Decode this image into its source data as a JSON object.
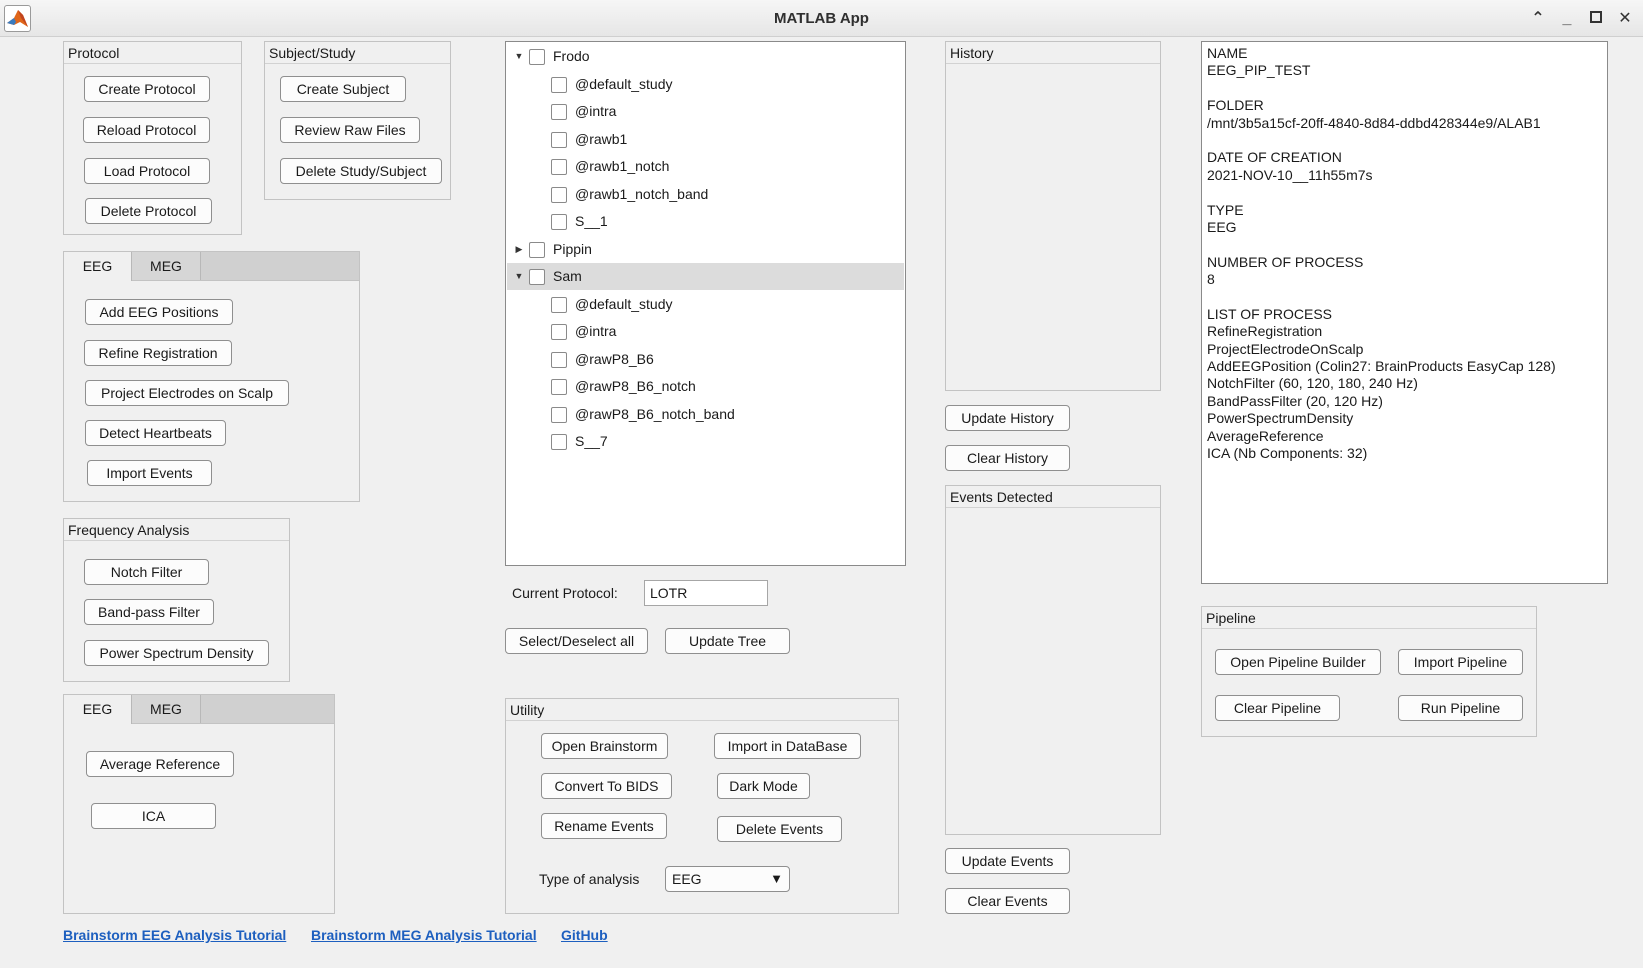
{
  "window": {
    "title": "MATLAB App",
    "icon": "matlab-logo-icon"
  },
  "protocol_panel": {
    "title": "Protocol",
    "buttons": [
      "Create Protocol",
      "Reload Protocol",
      "Load Protocol",
      "Delete Protocol"
    ]
  },
  "subject_panel": {
    "title": "Subject/Study",
    "buttons": [
      "Create Subject",
      "Review Raw Files",
      "Delete Study/Subject"
    ]
  },
  "tabs_top": {
    "tabs": [
      "EEG",
      "MEG"
    ],
    "active": "EEG",
    "buttons": [
      "Add EEG Positions",
      "Refine Registration",
      "Project Electrodes on Scalp",
      "Detect Heartbeats",
      "Import Events"
    ]
  },
  "frequency_panel": {
    "title": "Frequency Analysis",
    "buttons": [
      "Notch Filter",
      "Band-pass Filter",
      "Power Spectrum Density"
    ]
  },
  "tabs_bottom": {
    "tabs": [
      "EEG",
      "MEG"
    ],
    "active": "EEG",
    "buttons": [
      "Average Reference",
      "ICA"
    ]
  },
  "links": [
    "Brainstorm EEG Analysis Tutorial",
    "Brainstorm MEG Analysis Tutorial",
    "GitHub"
  ],
  "tree": {
    "nodes": [
      {
        "label": "Frodo",
        "level": 0,
        "expanded": true
      },
      {
        "label": "@default_study",
        "level": 1
      },
      {
        "label": "@intra",
        "level": 1
      },
      {
        "label": "@rawb1",
        "level": 1
      },
      {
        "label": "@rawb1_notch",
        "level": 1
      },
      {
        "label": "@rawb1_notch_band",
        "level": 1
      },
      {
        "label": "S__1",
        "level": 1
      },
      {
        "label": "Pippin",
        "level": 0,
        "expanded": false
      },
      {
        "label": "Sam",
        "level": 0,
        "expanded": true,
        "selected": true
      },
      {
        "label": "@default_study",
        "level": 1
      },
      {
        "label": "@intra",
        "level": 1
      },
      {
        "label": "@rawP8_B6",
        "level": 1
      },
      {
        "label": "@rawP8_B6_notch",
        "level": 1
      },
      {
        "label": "@rawP8_B6_notch_band",
        "level": 1
      },
      {
        "label": "S__7",
        "level": 1
      }
    ]
  },
  "current_protocol": {
    "label": "Current Protocol:",
    "value": "LOTR"
  },
  "tree_buttons": {
    "select_all": "Select/Deselect all",
    "update_tree": "Update Tree"
  },
  "utility_panel": {
    "title": "Utility",
    "buttons": {
      "open_brainstorm": "Open Brainstorm",
      "import_db": "Import in DataBase",
      "convert_bids": "Convert To BIDS",
      "dark_mode": "Dark Mode",
      "rename_events": "Rename Events",
      "delete_events": "Delete Events"
    },
    "analysis_label": "Type of analysis",
    "analysis_value": "EEG"
  },
  "history_panel": {
    "title": "History",
    "update": "Update History",
    "clear": "Clear History"
  },
  "events_panel": {
    "title": "Events Detected",
    "update": "Update Events",
    "clear": "Clear Events"
  },
  "info_text": [
    "NAME",
    "EEG_PIP_TEST",
    "",
    "FOLDER",
    "/mnt/3b5a15cf-20ff-4840-8d84-ddbd428344e9/ALAB1",
    "",
    "DATE OF CREATION",
    "2021-NOV-10__11h55m7s",
    "",
    "TYPE",
    "EEG",
    "",
    "NUMBER OF PROCESS",
    "8",
    "",
    "LIST OF PROCESS",
    "RefineRegistration",
    "ProjectElectrodeOnScalp",
    "AddEEGPosition (Colin27: BrainProducts EasyCap 128)",
    "NotchFilter (60, 120, 180, 240 Hz)",
    "BandPassFilter (20, 120 Hz)",
    "PowerSpectrumDensity",
    "AverageReference",
    "ICA (Nb Components: 32)"
  ],
  "pipeline_panel": {
    "title": "Pipeline",
    "buttons": [
      "Open Pipeline Builder",
      "Import Pipeline",
      "Clear Pipeline",
      "Run Pipeline"
    ]
  }
}
